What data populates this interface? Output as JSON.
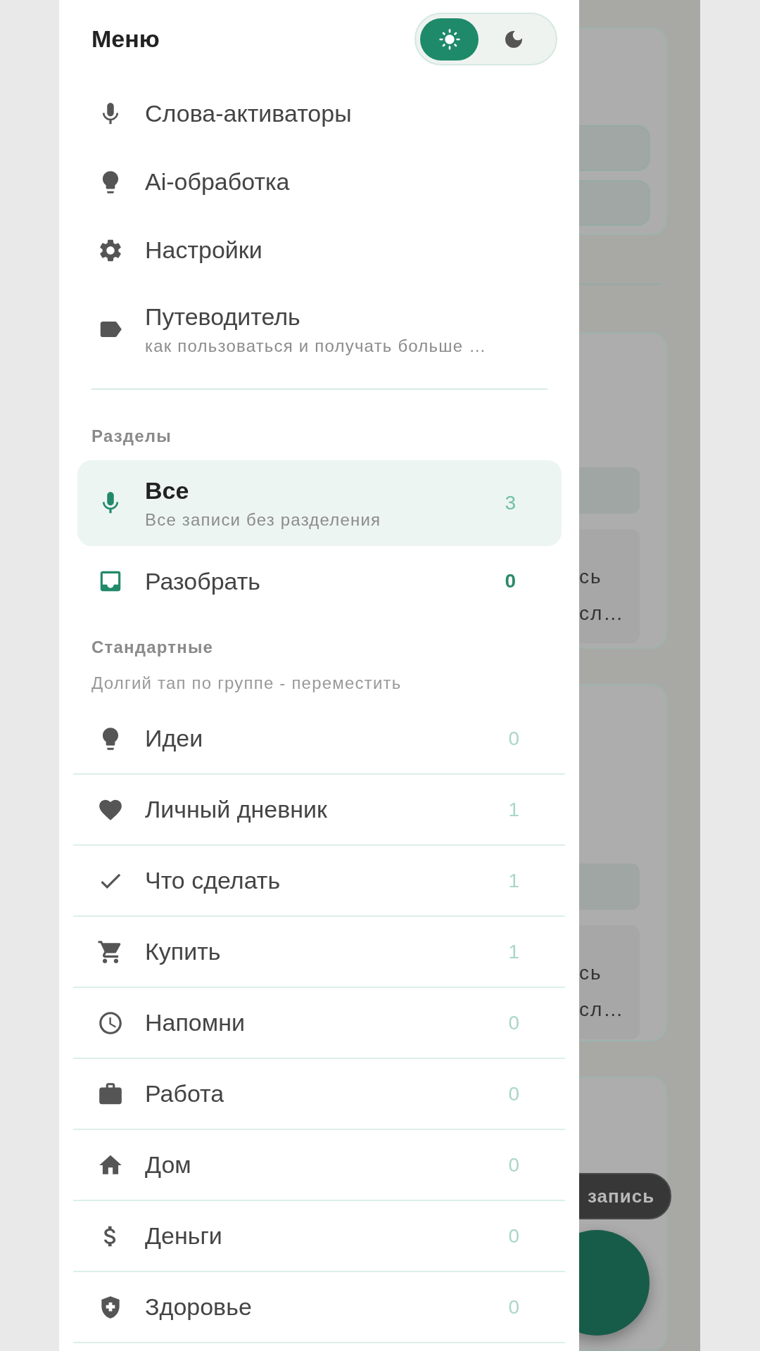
{
  "header": {
    "title": "Меню",
    "theme_toggle": [
      {
        "kind": "light",
        "selected": true
      },
      {
        "kind": "dark",
        "selected": false
      }
    ]
  },
  "menu": [
    {
      "label": "Слова-активаторы"
    },
    {
      "label": "Ai-обработка"
    },
    {
      "label": "Настройки"
    },
    {
      "label": "Путеводитель",
      "subtitle": "как пользоваться и получать больше …"
    }
  ],
  "sections": {
    "title": "Разделы",
    "items": [
      {
        "label": "Все",
        "subtitle": "Все записи без разделения",
        "count": "3",
        "selected": true,
        "emphasized": false
      },
      {
        "label": "Разобрать",
        "count": "0",
        "selected": false,
        "emphasized": true
      }
    ]
  },
  "groups": {
    "title": "Стандартные",
    "hint": "Долгий тап по группе - переместить",
    "items": [
      {
        "label": "Идеи",
        "count": "0"
      },
      {
        "label": "Личный дневник",
        "count": "1"
      },
      {
        "label": "Что сделать",
        "count": "1"
      },
      {
        "label": "Купить",
        "count": "1"
      },
      {
        "label": "Напомни",
        "count": "0"
      },
      {
        "label": "Работа",
        "count": "0"
      },
      {
        "label": "Дом",
        "count": "0"
      },
      {
        "label": "Деньги",
        "count": "0"
      },
      {
        "label": "Здоровье",
        "count": "0"
      }
    ]
  },
  "background": {
    "cards": [
      {
        "lines": [
          "сь",
          "сл…"
        ]
      },
      {
        "lines": [
          "сь",
          "сл…"
        ]
      }
    ],
    "tooltip": "запись"
  }
}
